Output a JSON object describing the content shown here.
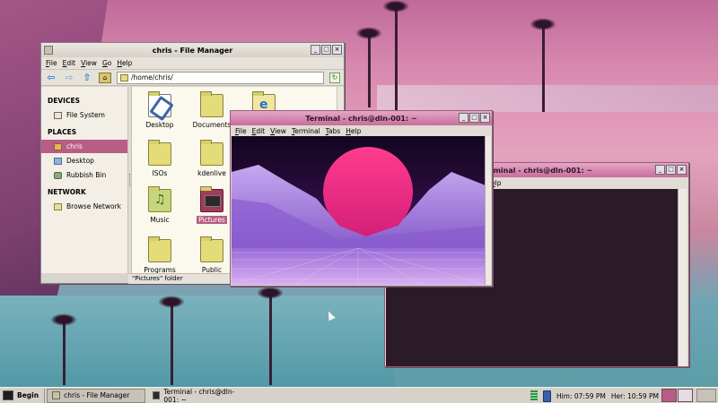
{
  "file_manager": {
    "title": "chris - File Manager",
    "menu": [
      "File",
      "Edit",
      "View",
      "Go",
      "Help"
    ],
    "path": "/home/chris/",
    "sidebar": {
      "devices_heading": "DEVICES",
      "devices": [
        {
          "label": "File System",
          "icon": "drive-icon"
        }
      ],
      "places_heading": "PLACES",
      "places": [
        {
          "label": "chris",
          "icon": "home-icon",
          "selected": true
        },
        {
          "label": "Desktop",
          "icon": "desktop-icon"
        },
        {
          "label": "Rubbish Bin",
          "icon": "trash-icon"
        }
      ],
      "network_heading": "NETWORK",
      "network": [
        {
          "label": "Browse Network",
          "icon": "network-icon"
        }
      ]
    },
    "files": [
      {
        "label": "Desktop",
        "icon": "desktop-folder-icon"
      },
      {
        "label": "Documents",
        "icon": "folder-icon"
      },
      {
        "label": "",
        "icon": "web-folder-icon"
      },
      {
        "label": "ISOs",
        "icon": "folder-icon"
      },
      {
        "label": "kdenlive",
        "icon": "folder-icon"
      },
      {
        "label": "Music",
        "icon": "music-folder-icon"
      },
      {
        "label": "Pictures",
        "icon": "pictures-folder-icon",
        "selected": true
      },
      {
        "label": "Programs",
        "icon": "folder-icon"
      },
      {
        "label": "Public",
        "icon": "folder-icon"
      }
    ],
    "status": "\"Pictures\" folder"
  },
  "terminal_front": {
    "title": "Terminal - chris@dln-001: ~",
    "menu": [
      "File",
      "Edit",
      "View",
      "Terminal",
      "Tabs",
      "Help"
    ]
  },
  "terminal_back": {
    "title": "Terminal - chris@dln-001: ~",
    "menu_visible": "elp"
  },
  "taskbar": {
    "start_label": "Begin",
    "tasks": [
      {
        "label": "chris - File Manager",
        "active": true
      },
      {
        "label": "Terminal - chris@dln-001: ~",
        "active": false
      }
    ],
    "clock_him": "Him: 07:59 PM",
    "clock_her": "Her: 10:59 PM"
  },
  "colors": {
    "accent": "#b85d85",
    "terminal_title": "#c86e9c",
    "taskbar": "#d6d2c9"
  }
}
